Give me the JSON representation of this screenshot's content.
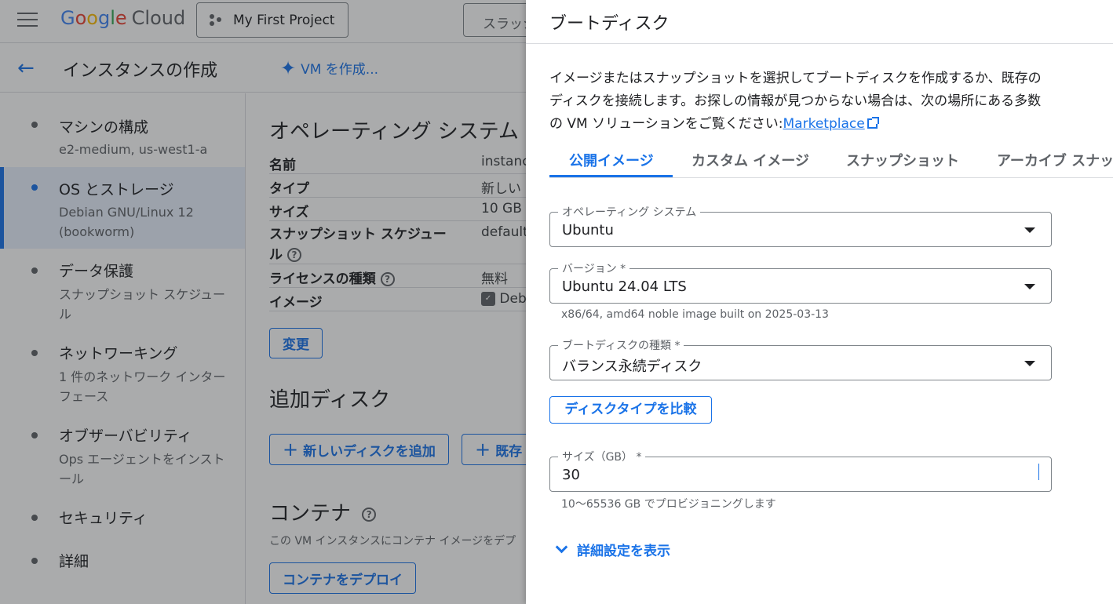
{
  "top_bar": {
    "logo_letters": [
      "G",
      "o",
      "o",
      "g",
      "l",
      "e"
    ],
    "logo_product": "Cloud",
    "project_label": "My First Project",
    "search_text": "スラッシ"
  },
  "sub_bar": {
    "page_title": "インスタンスの作成",
    "create_vm_label": "VM を作成..."
  },
  "sidenav": {
    "items": [
      {
        "title": "マシンの構成",
        "sub": "e2-medium, us-west1-a"
      },
      {
        "title": "OS とストレージ",
        "sub": "Debian GNU/Linux 12 (bookworm)"
      },
      {
        "title": "データ保護",
        "sub": "スナップショット スケジュール"
      },
      {
        "title": "ネットワーキング",
        "sub": "1 件のネットワーク インターフェース"
      },
      {
        "title": "オブザーバビリティ",
        "sub": "Ops エージェントをインストール"
      },
      {
        "title": "セキュリティ",
        "sub": ""
      },
      {
        "title": "詳細",
        "sub": ""
      }
    ]
  },
  "main": {
    "os_section_title": "オペレーティング システム",
    "rows": [
      {
        "key": "名前",
        "value": "instanc"
      },
      {
        "key": "タイプ",
        "value": "新しい"
      },
      {
        "key": "サイズ",
        "value": "10 GB"
      },
      {
        "key_line1": "スナップショット スケジュー",
        "key_line2": "ル",
        "value": "default-"
      },
      {
        "key": "ライセンスの種類",
        "value": "無料"
      },
      {
        "key": "イメージ",
        "value": "Deb"
      }
    ],
    "change_button": "変更",
    "additional_disks_title": "追加ディスク",
    "add_new_disk_button": "新しいディスクを追加",
    "add_existing_disk_button": "既存",
    "container_title": "コンテナ",
    "container_note": "この VM インスタンスにコンテナ イメージをデプ",
    "deploy_container_button": "コンテナをデプロイ"
  },
  "panel": {
    "title": "ブートディスク",
    "description": "イメージまたはスナップショットを選択してブートディスクを作成するか、既存のディスクを接続します。お探しの情報が見つからない場合は、次の場所にある多数の VM ソリューションをご覧ください:",
    "marketplace_link": "Marketplace",
    "tabs": [
      "公開イメージ",
      "カスタム イメージ",
      "スナップショット",
      "アーカイブ スナップ"
    ],
    "active_tab": "公開イメージ",
    "os_field": {
      "label": "オペレーティング システム",
      "value": "Ubuntu"
    },
    "version_field": {
      "label": "バージョン *",
      "value": "Ubuntu 24.04 LTS",
      "hint": "x86/64, amd64 noble image built on 2025-03-13"
    },
    "disk_type_field": {
      "label": "ブートディスクの種類 *",
      "value": "バランス永続ディスク"
    },
    "compare_button": "ディスクタイプを比較",
    "size_field": {
      "label": "サイズ（GB） *",
      "value": "30",
      "hint": "10〜65536 GB でプロビジョニングします"
    },
    "advanced_link": "詳細設定を表示"
  },
  "colors": {
    "accent": "#1a73e8",
    "scrim": "rgba(32,33,36,0.38)"
  }
}
